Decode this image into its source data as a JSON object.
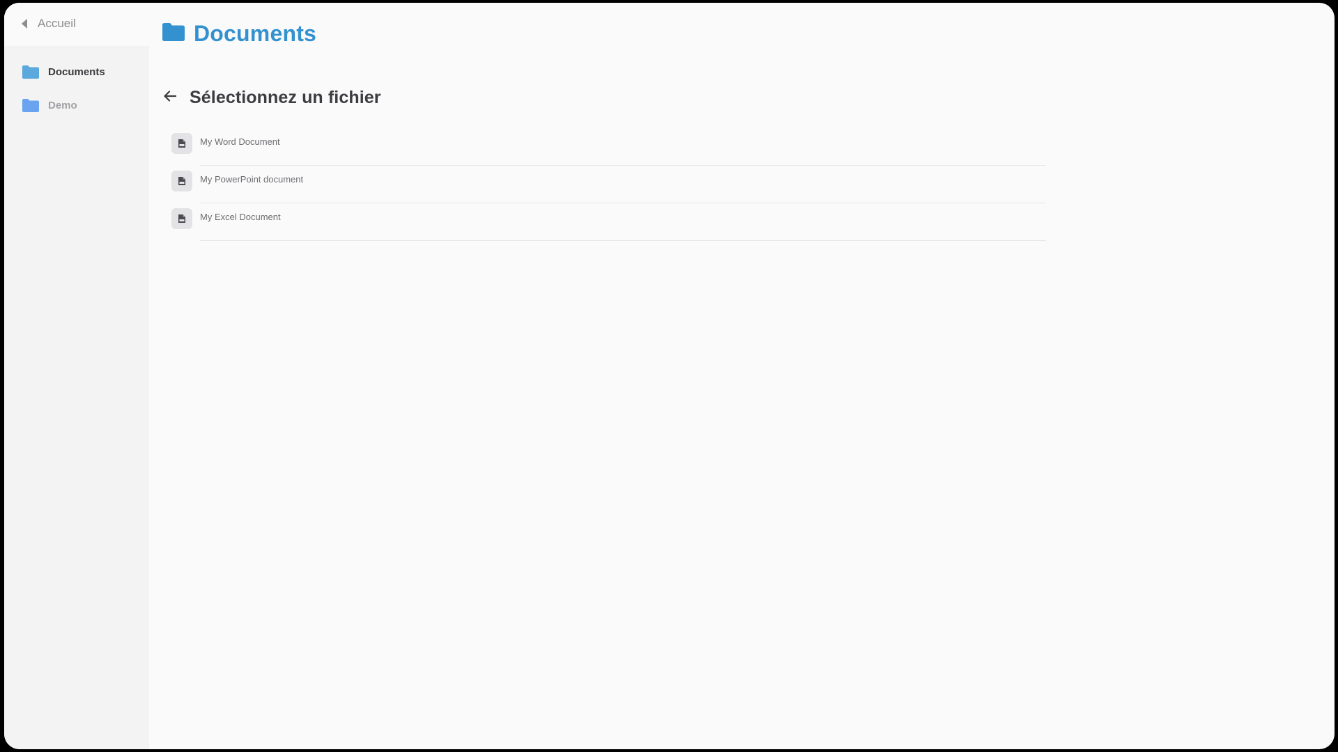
{
  "sidebar": {
    "back_label": "Accueil",
    "items": [
      {
        "label": "Documents",
        "icon": "folder-icon",
        "active": true,
        "color": "#5aa8dc"
      },
      {
        "label": "Demo",
        "icon": "folder-icon",
        "active": false,
        "color": "#6aa3f0"
      }
    ]
  },
  "header": {
    "title": "Documents",
    "icon": "folder-icon",
    "accent_color": "#3491cf"
  },
  "main": {
    "subtitle": "Sélectionnez un fichier",
    "back_icon": "arrow-left-icon",
    "files": [
      {
        "name": "My Word Document",
        "icon": "pdf-file-icon"
      },
      {
        "name": "My PowerPoint document",
        "icon": "pdf-file-icon"
      },
      {
        "name": "My Excel Document",
        "icon": "pdf-file-icon"
      }
    ]
  }
}
